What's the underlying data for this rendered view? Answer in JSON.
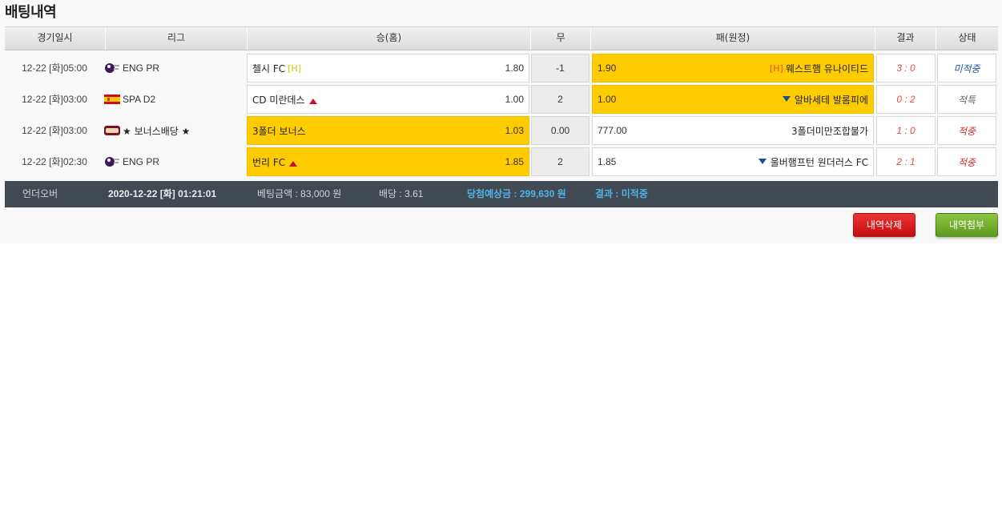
{
  "page": {
    "title": "배팅내역"
  },
  "columns": [
    "경기일시",
    "리그",
    "승(홈)",
    "무",
    "패(원정)",
    "결과",
    "상태"
  ],
  "rows": [
    {
      "date": "12-22 [화]05:00",
      "league": "ENG PR",
      "league_icon": "premier-league-logo-icon",
      "home": {
        "team": "첼시 FC",
        "mark": "[H]",
        "odds": "1.80",
        "selected": false,
        "arrow": ""
      },
      "draw": "-1",
      "away": {
        "team": "웨스트햄 유나이티드",
        "mark": "[H]",
        "odds": "1.90",
        "selected": true,
        "arrow": ""
      },
      "result": "3 : 0",
      "status": "미적중",
      "status_color": "#2255aa"
    },
    {
      "date": "12-22 [화]03:00",
      "league": "SPA D2",
      "league_icon": "spain-flag-icon",
      "home": {
        "team": "CD 미란데스",
        "mark": "",
        "odds": "1.00",
        "selected": false,
        "arrow": "up"
      },
      "draw": "2",
      "away": {
        "team": "알바세테 발롬피에",
        "mark": "",
        "odds": "1.00",
        "selected": true,
        "arrow": "down"
      },
      "result": "0 : 2",
      "status": "적특",
      "status_color": "#666666"
    },
    {
      "date": "12-22 [화]03:00",
      "league": "★ 보너스배당 ★",
      "league_icon": "bonus-badge-icon",
      "home": {
        "team": "3폴더 보너스",
        "mark": "",
        "odds": "1.03",
        "selected": true,
        "arrow": ""
      },
      "draw": "0.00",
      "away": {
        "team": "3폴더미만조합불가",
        "mark": "",
        "odds": "777.00",
        "selected": false,
        "arrow": ""
      },
      "result": "1 : 0",
      "status": "적중",
      "status_color": "#d32f2f"
    },
    {
      "date": "12-22 [화]02:30",
      "league": "ENG PR",
      "league_icon": "premier-league-logo-icon",
      "home": {
        "team": "번리 FC",
        "mark": "",
        "odds": "1.85",
        "selected": true,
        "arrow": "up"
      },
      "draw": "2",
      "away": {
        "team": "울버햄프턴 원더러스 FC",
        "mark": "",
        "odds": "1.85",
        "selected": false,
        "arrow": "down"
      },
      "result": "2 : 1",
      "status": "적중",
      "status_color": "#d32f2f"
    }
  ],
  "summary": {
    "type": "언더오버",
    "datetime": "2020-12-22 [화] 01:21:01",
    "bet_amount": "베팅금액 : 83,000 원",
    "odds": "배당 : 3.61",
    "expected_win": "당첨예상금 : 299,630 원",
    "result": "결과 : 미적중"
  },
  "buttons": {
    "delete": "내역삭제",
    "attach": "내역첨부"
  },
  "colors": {
    "selected": "#fecc00",
    "summary_bg": "#414a52",
    "delete_btn": "#d41418",
    "attach_btn": "#6eab2b",
    "highlight_blue": "#4fb3e8"
  }
}
